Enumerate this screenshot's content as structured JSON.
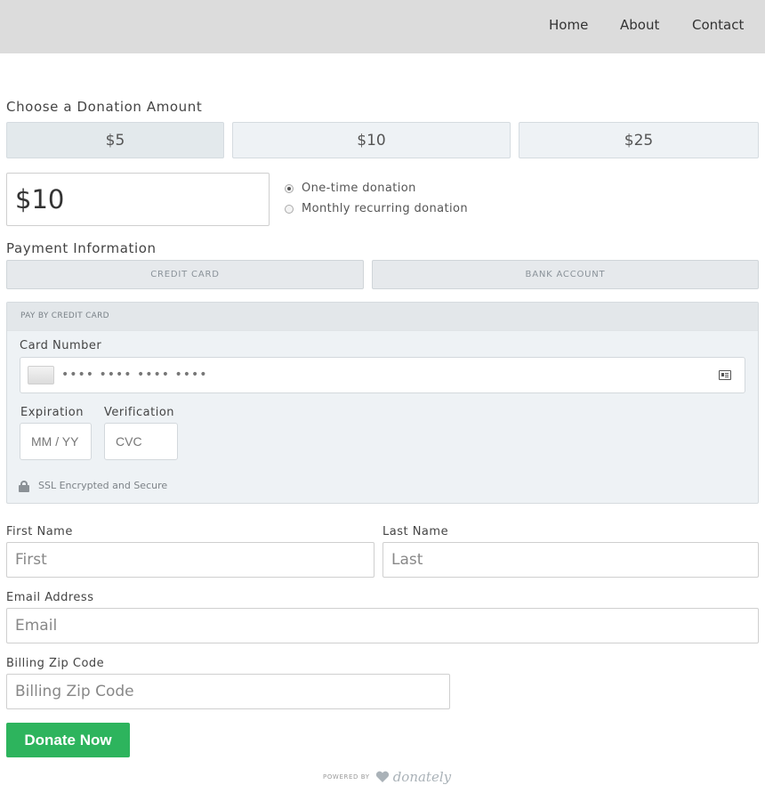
{
  "nav": {
    "links": [
      "Home",
      "About",
      "Contact"
    ]
  },
  "donation": {
    "title": "Choose a Donation Amount",
    "amounts": [
      "$5",
      "$10",
      "$25"
    ],
    "selected_amount": "$5",
    "custom_amount_value": "$10",
    "frequency_options": [
      "One-time donation",
      "Monthly recurring donation"
    ],
    "selected_frequency": "One-time donation"
  },
  "payment": {
    "title": "Payment Information",
    "tabs": [
      "CREDIT CARD",
      "BANK ACCOUNT"
    ],
    "panel_header": "PAY BY CREDIT CARD",
    "card_number_label": "Card Number",
    "card_number_placeholder": "•••• •••• •••• ••••",
    "expiration_label": "Expiration",
    "expiration_placeholder": "MM / YY",
    "verification_label": "Verification",
    "verification_placeholder": "CVC",
    "ssl_text": "SSL Encrypted and Secure"
  },
  "personal": {
    "first_name_label": "First Name",
    "first_name_placeholder": "First",
    "last_name_label": "Last Name",
    "last_name_placeholder": "Last",
    "email_label": "Email Address",
    "email_placeholder": "Email",
    "zip_label": "Billing Zip Code",
    "zip_placeholder": "Billing Zip Code"
  },
  "submit": {
    "label": "Donate Now"
  },
  "footer": {
    "powered_by": "POWERED BY",
    "brand": "donately"
  },
  "colors": {
    "nav_background": "#dcdcdc",
    "primary_button": "#2db45d",
    "panel_background": "#eef2f5"
  },
  "icons": {
    "card": "credit-card-icon",
    "card_type": "id-card-icon",
    "lock": "lock-icon",
    "brand": "heart-icon"
  }
}
